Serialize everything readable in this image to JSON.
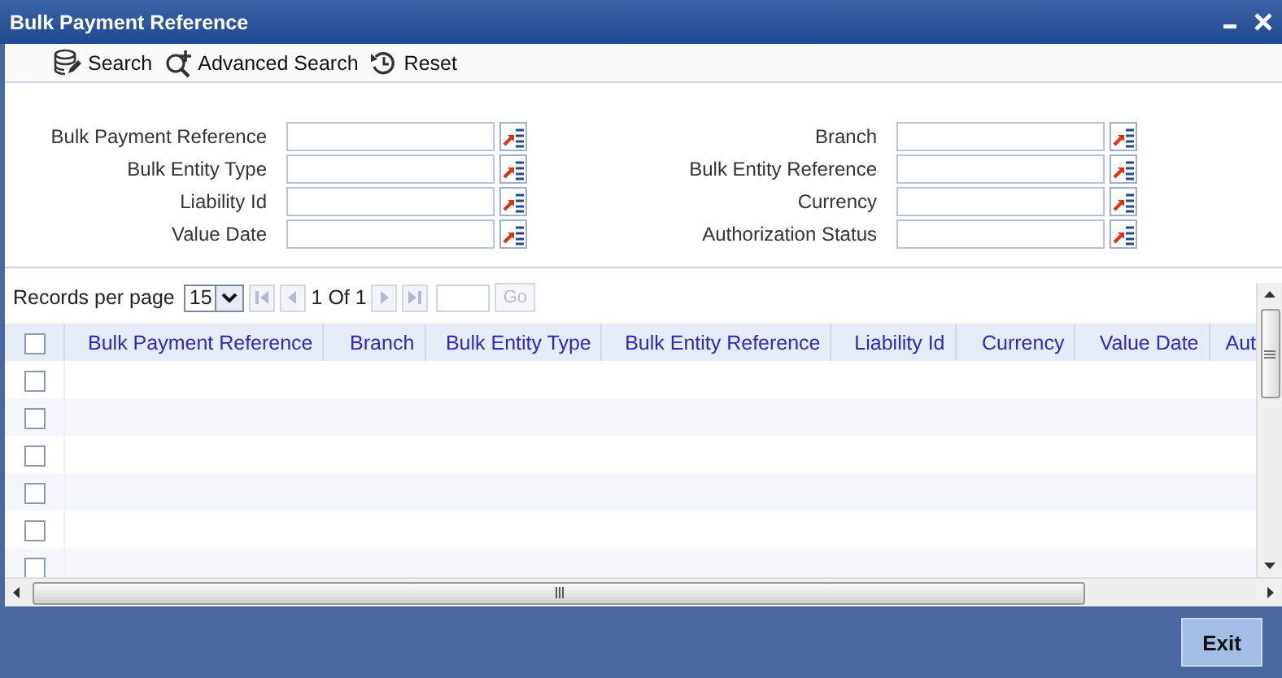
{
  "window": {
    "title": "Bulk Payment Reference"
  },
  "toolbar": [
    {
      "label": "Search",
      "kind": "search"
    },
    {
      "label": "Advanced Search",
      "kind": "advanced"
    },
    {
      "label": "Reset",
      "kind": "reset"
    }
  ],
  "form": {
    "left": [
      {
        "label": "Bulk Payment Reference"
      },
      {
        "label": "Bulk Entity Type"
      },
      {
        "label": "Liability Id"
      },
      {
        "label": "Value Date"
      }
    ],
    "right": [
      {
        "label": "Branch"
      },
      {
        "label": "Bulk Entity Reference"
      },
      {
        "label": "Currency"
      },
      {
        "label": "Authorization Status"
      }
    ]
  },
  "pagination": {
    "label": "Records per page",
    "page_size": "15",
    "page_info": "1 Of 1",
    "go": {
      "label": "Go",
      "disabled": true
    },
    "nav": [
      {
        "kind": "first",
        "disabled": true
      },
      {
        "kind": "prev",
        "disabled": true
      },
      {
        "kind": "next",
        "disabled": true
      },
      {
        "kind": "last",
        "disabled": true
      }
    ]
  },
  "table": {
    "select_all": {
      "checked": false
    },
    "columns": [
      "Bulk Payment Reference",
      "Branch",
      "Bulk Entity Type",
      "Bulk Entity Reference",
      "Liability Id",
      "Currency",
      "Value Date",
      "Aut"
    ],
    "rows": [
      {
        "checked": false
      },
      {
        "checked": false
      },
      {
        "checked": false
      },
      {
        "checked": false
      },
      {
        "checked": false
      },
      {
        "checked": false
      }
    ]
  },
  "buttons": [
    {
      "label": "Exit"
    }
  ]
}
